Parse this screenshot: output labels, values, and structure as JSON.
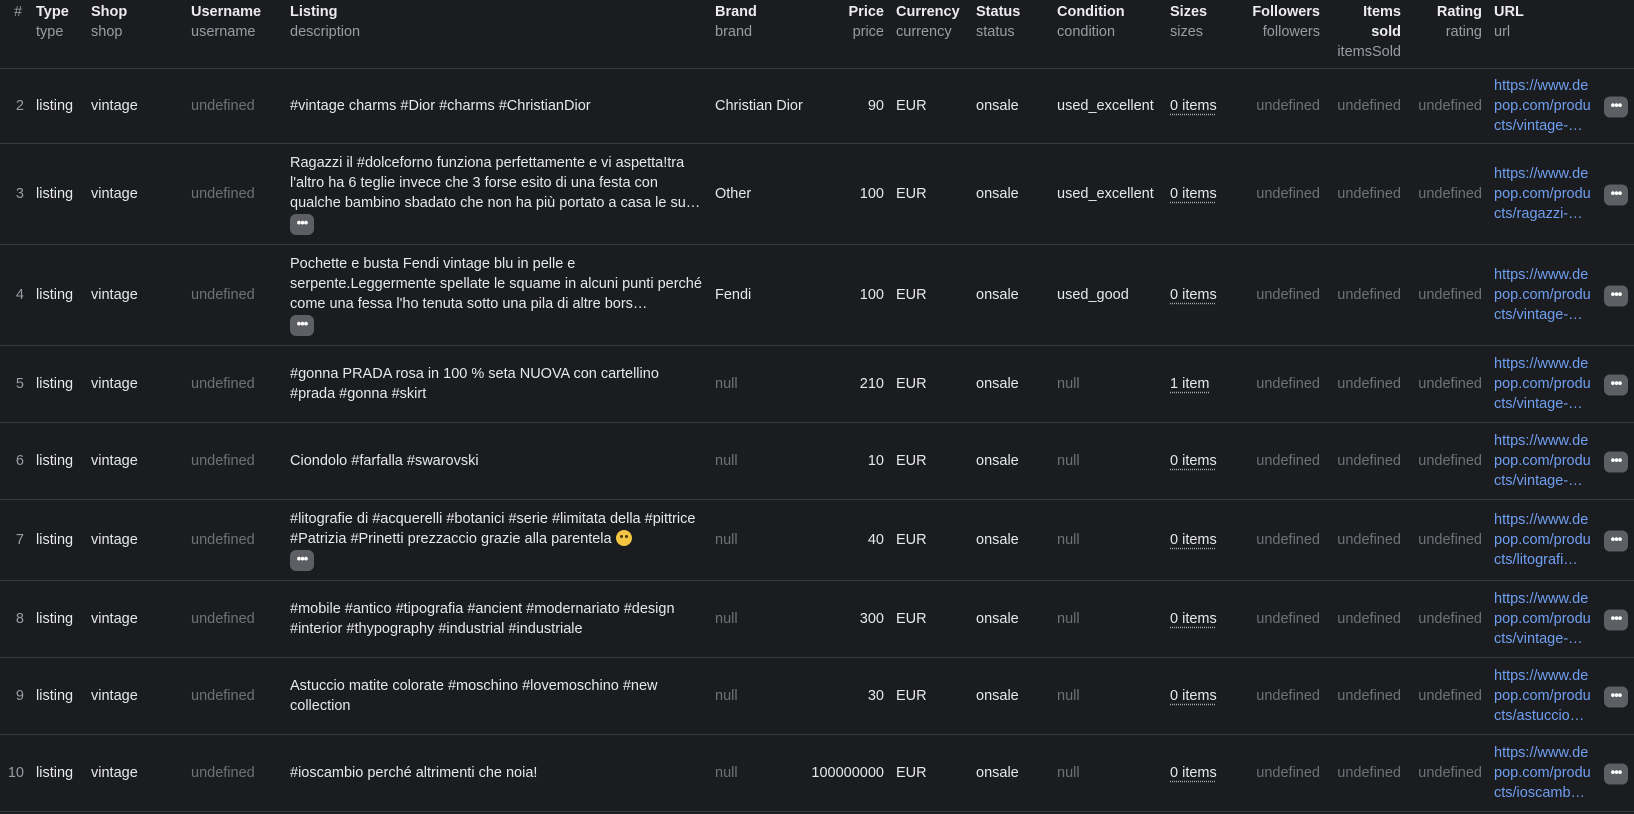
{
  "headers": [
    {
      "main": "#",
      "sub": ""
    },
    {
      "main": "Type",
      "sub": "type"
    },
    {
      "main": "Shop",
      "sub": "shop"
    },
    {
      "main": "Username",
      "sub": "username"
    },
    {
      "main": "Listing",
      "sub": "description"
    },
    {
      "main": "Brand",
      "sub": "brand"
    },
    {
      "main": "Price",
      "sub": "price"
    },
    {
      "main": "Currency",
      "sub": "currency"
    },
    {
      "main": "Status",
      "sub": "status"
    },
    {
      "main": "Condition",
      "sub": "condition"
    },
    {
      "main": "Sizes",
      "sub": "sizes"
    },
    {
      "main": "Followers",
      "sub": "followers"
    },
    {
      "main": "Items sold",
      "sub": "itemsSold"
    },
    {
      "main": "Rating",
      "sub": "rating"
    },
    {
      "main": "URL",
      "sub": "url"
    }
  ],
  "more_glyph": "•••",
  "rows": [
    {
      "num": "2",
      "type": "listing",
      "shop": "vintage",
      "username": "undefined",
      "description": "#vintage charms #Dior #charms #ChristianDior",
      "brand": "Christian Dior",
      "price": "90",
      "currency": "EUR",
      "status": "onsale",
      "condition": "used_excellent",
      "sizes": "0 items",
      "followers": "undefined",
      "items_sold": "undefined",
      "rating": "undefined",
      "url": "https://www.depop.com/products/vintage-…"
    },
    {
      "num": "3",
      "type": "listing",
      "shop": "vintage",
      "username": "undefined",
      "description": "Ragazzi il #dolceforno funziona perfettamente e vi aspetta!tra l'altro ha 6 teglie invece che 3 forse esito di una festa con qualche bambino sbadato che non ha più portato a casa le su…",
      "brand": "Other",
      "price": "100",
      "currency": "EUR",
      "status": "onsale",
      "condition": "used_excellent",
      "sizes": "0 items",
      "followers": "undefined",
      "items_sold": "undefined",
      "rating": "undefined",
      "url": "https://www.depop.com/products/ragazzi-…"
    },
    {
      "num": "4",
      "type": "listing",
      "shop": "vintage",
      "username": "undefined",
      "description": "Pochette e busta Fendi vintage blu in pelle e serpente.Leggermente spellate le squame in alcuni punti perché come una fessa l'ho tenuta sotto una pila di altre bors…",
      "brand": "Fendi",
      "price": "100",
      "currency": "EUR",
      "status": "onsale",
      "condition": "used_good",
      "sizes": "0 items",
      "followers": "undefined",
      "items_sold": "undefined",
      "rating": "undefined",
      "url": "https://www.depop.com/products/vintage-…"
    },
    {
      "num": "5",
      "type": "listing",
      "shop": "vintage",
      "username": "undefined",
      "description": "#gonna PRADA rosa in 100 % seta NUOVA con cartellino #prada #gonna #skirt",
      "brand": "null",
      "price": "210",
      "currency": "EUR",
      "status": "onsale",
      "condition": "null",
      "sizes": "1 item",
      "followers": "undefined",
      "items_sold": "undefined",
      "rating": "undefined",
      "url": "https://www.depop.com/products/vintage-…"
    },
    {
      "num": "6",
      "type": "listing",
      "shop": "vintage",
      "username": "undefined",
      "description": "Ciondolo #farfalla #swarovski",
      "brand": "null",
      "price": "10",
      "currency": "EUR",
      "status": "onsale",
      "condition": "null",
      "sizes": "0 items",
      "followers": "undefined",
      "items_sold": "undefined",
      "rating": "undefined",
      "url": "https://www.depop.com/products/vintage-…"
    },
    {
      "num": "7",
      "type": "listing",
      "shop": "vintage",
      "username": "undefined",
      "description": "#litografie di #acquerelli #botanici #serie #limitata della #pittrice #Patrizia #Prinetti prezzaccio grazie alla parentela",
      "brand": "null",
      "price": "40",
      "currency": "EUR",
      "status": "onsale",
      "condition": "null",
      "sizes": "0 items",
      "followers": "undefined",
      "items_sold": "undefined",
      "rating": "undefined",
      "url": "https://www.depop.com/products/litografi…"
    },
    {
      "num": "8",
      "type": "listing",
      "shop": "vintage",
      "username": "undefined",
      "description": "#mobile #antico #tipografia #ancient #modernariato #design #interior #thypography #industrial #industriale",
      "brand": "null",
      "price": "300",
      "currency": "EUR",
      "status": "onsale",
      "condition": "null",
      "sizes": "0 items",
      "followers": "undefined",
      "items_sold": "undefined",
      "rating": "undefined",
      "url": "https://www.depop.com/products/vintage-…"
    },
    {
      "num": "9",
      "type": "listing",
      "shop": "vintage",
      "username": "undefined",
      "description": "Astuccio matite colorate #moschino #lovemoschino #new collection",
      "brand": "null",
      "price": "30",
      "currency": "EUR",
      "status": "onsale",
      "condition": "null",
      "sizes": "0 items",
      "followers": "undefined",
      "items_sold": "undefined",
      "rating": "undefined",
      "url": "https://www.depop.com/products/astuccio…"
    },
    {
      "num": "10",
      "type": "listing",
      "shop": "vintage",
      "username": "undefined",
      "description": "#ioscambio perché altrimenti che noia!",
      "brand": "null",
      "price": "100000000",
      "currency": "EUR",
      "status": "onsale",
      "condition": "null",
      "sizes": "0 items",
      "followers": "undefined",
      "items_sold": "undefined",
      "rating": "undefined",
      "url": "https://www.depop.com/products/ioscamb…"
    }
  ]
}
